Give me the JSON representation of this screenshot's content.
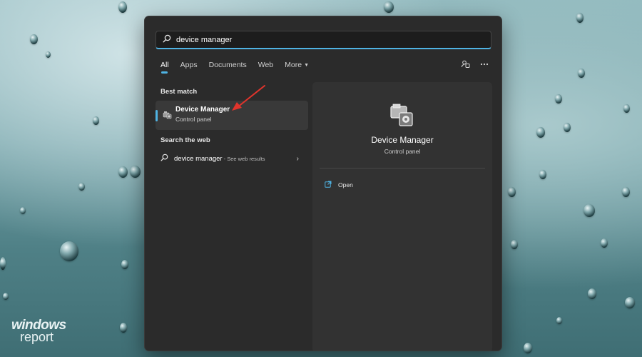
{
  "search": {
    "value": "device manager",
    "icon": "search-icon"
  },
  "tabs": [
    {
      "label": "All",
      "active": true
    },
    {
      "label": "Apps",
      "active": false
    },
    {
      "label": "Documents",
      "active": false
    },
    {
      "label": "Web",
      "active": false
    },
    {
      "label": "More",
      "active": false
    }
  ],
  "best_match": {
    "heading": "Best match",
    "title": "Device Manager",
    "subtitle": "Control panel"
  },
  "web_search": {
    "heading": "Search the web",
    "query": "device manager",
    "suffix": " - See web results"
  },
  "detail": {
    "title": "Device Manager",
    "subtitle": "Control panel",
    "open_label": "Open"
  },
  "watermark": {
    "line1": "windows",
    "line2": "report"
  },
  "colors": {
    "accent": "#4fb3e3",
    "panel": "#2b2b2b",
    "arrow": "#e0342c"
  }
}
